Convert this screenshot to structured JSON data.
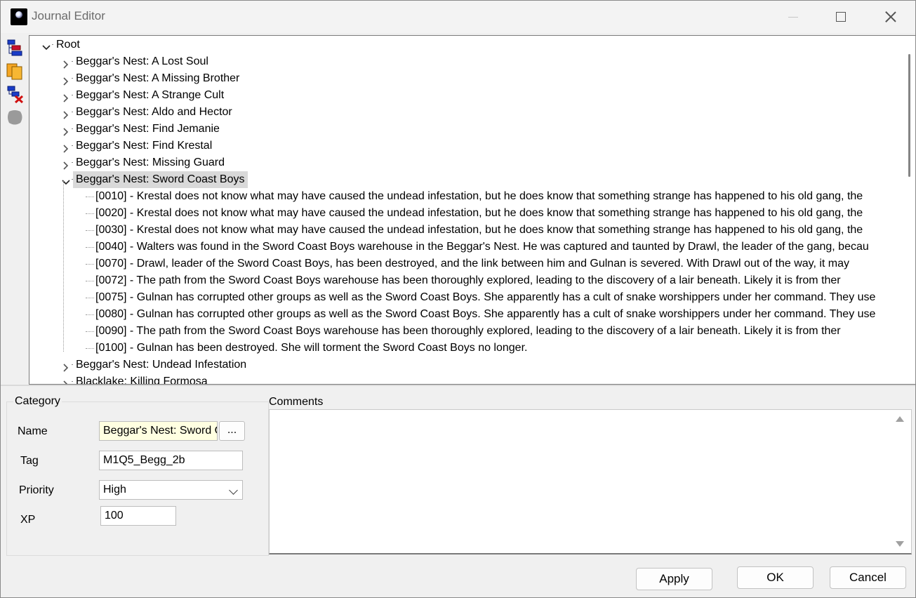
{
  "window": {
    "title": "Journal Editor"
  },
  "tree": {
    "root_label": "Root",
    "items": [
      "Beggar's Nest: A Lost Soul",
      "Beggar's Nest: A Missing Brother",
      "Beggar's Nest: A Strange Cult",
      "Beggar's Nest: Aldo and Hector",
      "Beggar's Nest: Find Jemanie",
      "Beggar's Nest: Find Krestal",
      "Beggar's Nest: Missing Guard",
      "Beggar's Nest: Sword Coast Boys"
    ],
    "expanded_entries": [
      "[0010] - Krestal does not know what may have caused the undead infestation, but he does know that something strange has happened to his old gang, the",
      "[0020] - Krestal does not know what may have caused the undead infestation, but he does know that something strange has happened to his old gang, the",
      "[0030] - Krestal does not know what may have caused the undead infestation, but he does know that something strange has happened to his old gang, the",
      "[0040] - Walters was found in the Sword Coast Boys warehouse in the Beggar's Nest. He was captured and taunted by Drawl, the leader of the gang, becau",
      "[0070] - Drawl, leader of the Sword Coast Boys, has been destroyed, and the link between him and Gulnan is severed. With Drawl out of the way, it may",
      "[0072] - The path from the Sword Coast Boys warehouse has been thoroughly explored, leading to the discovery of a lair beneath. Likely it is from ther",
      "[0075] - Gulnan has corrupted other groups as well as the Sword Coast Boys. She apparently has a cult of snake worshippers under her command. They use",
      "[0080] - Gulnan has corrupted other groups as well as the Sword Coast Boys. She apparently has a cult of snake worshippers under her command. They use",
      "[0090] - The path from the Sword Coast Boys warehouse has been thoroughly explored, leading to the discovery of a lair beneath. Likely it is from ther",
      "[0100] - Gulnan has been destroyed. She will torment the Sword Coast Boys no longer."
    ],
    "after_items": [
      "Beggar's Nest: Undead Infestation",
      "Blacklake: Killing Formosa"
    ]
  },
  "category": {
    "group_title": "Category",
    "name_label": "Name",
    "name_value": "Beggar's Nest: Sword Coast Boys",
    "browse_label": "...",
    "tag_label": "Tag",
    "tag_value": "M1Q5_Begg_2b",
    "priority_label": "Priority",
    "priority_value": "High",
    "xp_label": "XP",
    "xp_value": "100"
  },
  "comments": {
    "title": "Comments",
    "value": ""
  },
  "buttons": {
    "apply": "Apply",
    "ok": "OK",
    "cancel": "Cancel"
  }
}
